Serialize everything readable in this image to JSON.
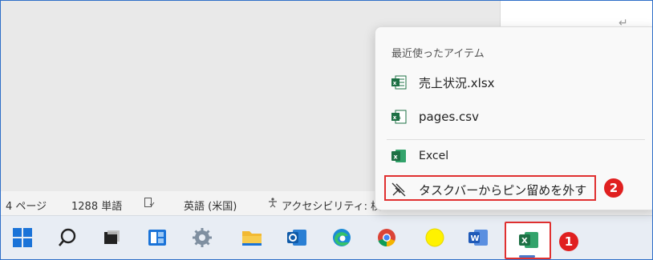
{
  "document": {
    "para_mark": "↵"
  },
  "statusbar": {
    "pages": "4 ページ",
    "words": "1288 単語",
    "language": "英語 (米国)",
    "accessibility": "アクセシビリティ: 検討が必要です"
  },
  "jumplist": {
    "header": "最近使ったアイテム",
    "recent": [
      {
        "label": "売上状況.xlsx",
        "icon": "excel-file-icon"
      },
      {
        "label": "pages.csv",
        "icon": "csv-file-icon"
      }
    ],
    "app_label": "Excel",
    "unpin_label": "タスクバーからピン留めを外す"
  },
  "taskbar": {
    "icons": [
      "start-icon",
      "search-icon",
      "task-view-icon",
      "widgets-icon",
      "settings-icon",
      "file-explorer-icon",
      "outlook-icon",
      "edge-icon",
      "chrome-icon",
      "yellow-app-icon",
      "word-icon",
      "excel-icon"
    ]
  },
  "annotations": {
    "badge1": "1",
    "badge2": "2"
  },
  "colors": {
    "highlight": "#e03030",
    "excel_green": "#1d7044",
    "accent": "#2f6fc8"
  }
}
